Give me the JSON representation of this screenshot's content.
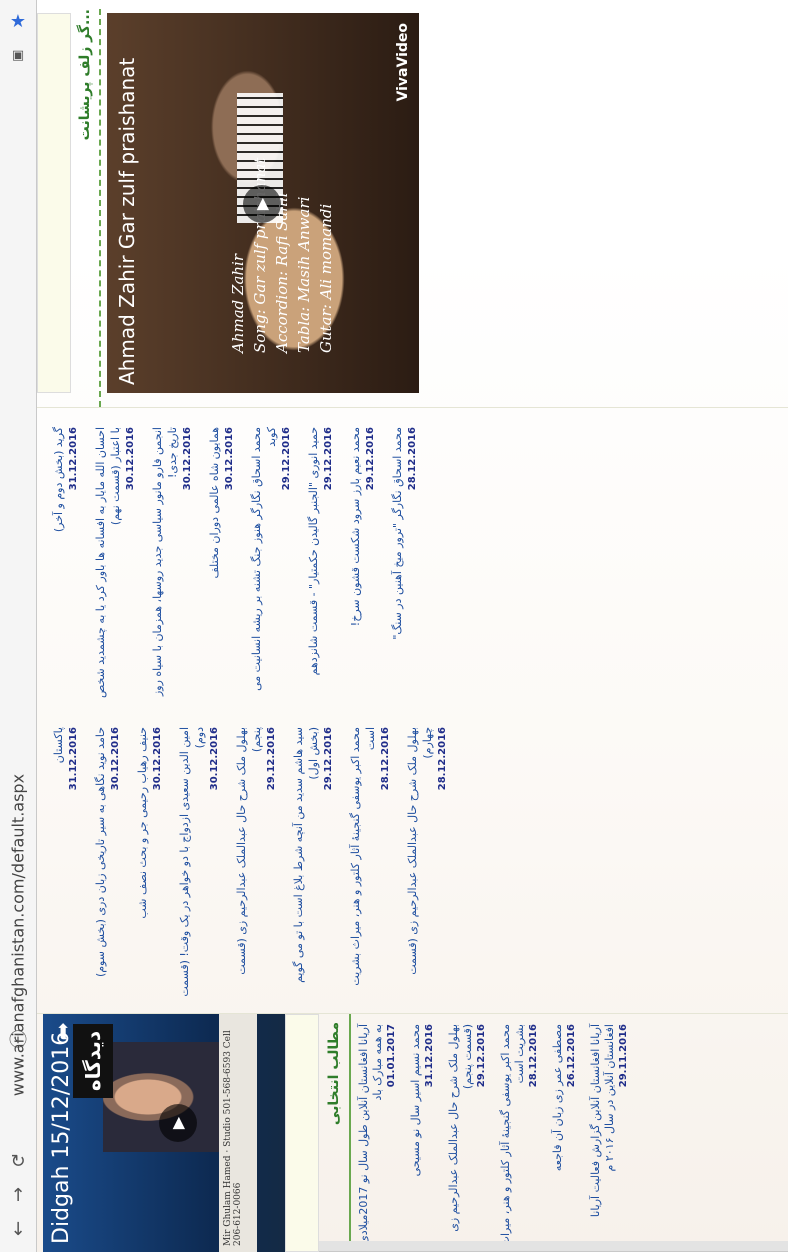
{
  "browser": {
    "url": "www.arianafghanistan.com/default.aspx"
  },
  "video_didgah": {
    "title": "Didgah 15/12/2016",
    "logo": "دیدگاه",
    "ribbon": "Mir Ghulam Hamed  ·  Studio 501-568-6593  Cell 206-612-0066"
  },
  "selected": {
    "heading": "مطالب انتخابی",
    "items": [
      {
        "text": "آریانا افغانستان آنلاین طول سال نو 2017میلادی به همه مبارک باد",
        "date": "01.01.2017"
      },
      {
        "text": "محمد نسیم اسیر سال نو مسیحی",
        "date": "31.12.2016"
      },
      {
        "text": "بهلول ملک شرح حال عبدالملک عبدالرحیم زی (قسمت پنجم)",
        "date": "29.12.2016"
      },
      {
        "text": "محمد اکبر یوسفی گنجینۀ آثار کلتور و هنر، میراث بشریت است",
        "date": "28.12.2016"
      },
      {
        "text": "مصطفی عمر زی زبان آن فاجعه",
        "date": "26.12.2016"
      },
      {
        "text": "آریانا افغانستان آنلاین گزارش فعالیت آریانا افغانستان آنلاین در سال ۲۰۱۶ م",
        "date": "29.11.2016"
      }
    ]
  },
  "articles_right": [
    {
      "text": "گرید (بخش دوم و آخر)",
      "date": "31.12.2016"
    },
    {
      "text": "احسان الله مایار به افسانه ها باور کرد یا به چشمدید شخص با اعتبار (قسمت نهم)",
      "date": "30.12.2016"
    },
    {
      "text": "انجمن فارو مانور سیاسی جدید روسها، همزمان با سیاه روز تاریخ جدی!",
      "date": "30.12.2016"
    },
    {
      "text": "همایون شاه عالمی دوران مختلف",
      "date": "30.12.2016"
    },
    {
      "text": "محمد اسحاق نگارگر هنوز جنگ تشنه بر ریشه انسانیت می کوبد",
      "date": "29.12.2016"
    },
    {
      "text": "حمید انوری \"الجنبر گالیدن حکمتیار\" - قسمت شانزدهم",
      "date": "29.12.2016"
    },
    {
      "text": "محمد نعیم بارز سرود شکست قشون سرخ!",
      "date": "29.12.2016"
    },
    {
      "text": "محمد اسحاق نگارگر \"ترور میخ آهنین در سنگ\"",
      "date": "28.12.2016"
    }
  ],
  "articles_left": [
    {
      "text": "پاکستان",
      "date": "31.12.2016"
    },
    {
      "text": "حامد نوید نگاهی به سیر تاریخی زبان دری (بخش سوم)",
      "date": "30.12.2016"
    },
    {
      "text": "حنیف رهیاب رحیمی جر و بحث نصف شب",
      "date": "30.12.2016"
    },
    {
      "text": "امین الدین سعیدی ازدواج با دو خواهر در یک وقت! (قسمت دوم)",
      "date": "30.12.2016"
    },
    {
      "text": "بهلول ملک شرح حال عبدالملک عبدالرحیم زی (قسمت پنجم)",
      "date": "29.12.2016"
    },
    {
      "text": "سید هاشم سدید من آنچه شرط بلاغ است با تو می گویم (بخش اول)",
      "date": "29.12.2016"
    },
    {
      "text": "محمد اکبر یوسفی گنجینۀ آثار کلتور و هنر، میراث بشریت است",
      "date": "28.12.2016"
    },
    {
      "text": "بهلول ملک شرح حال عبدالملک عبدالرحیم زی (قسمت چهارم)",
      "date": "28.12.2016"
    }
  ],
  "music": {
    "heading": "گر زلف پریشانت...",
    "title": "Ahmad Zahir Gar zulf praishanat",
    "credits": [
      "Ahmad Zahir",
      "Song: Gar zulf praishanat",
      "Accordion: Rafi Sahil",
      "Tabla: Masih Anwari",
      "Gutar: Ali momandi"
    ],
    "brand": "VivaVideo"
  }
}
